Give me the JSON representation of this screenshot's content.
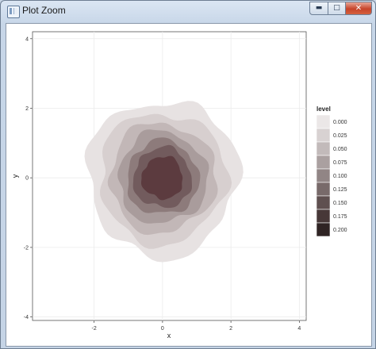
{
  "window": {
    "title": "Plot Zoom",
    "min_glyph": "▬",
    "max_glyph": "□",
    "close_glyph": "✕"
  },
  "chart_data": {
    "type": "contour",
    "title": "",
    "xlabel": "x",
    "ylabel": "y",
    "xlim": [
      -3.8,
      4.2
    ],
    "ylim": [
      -4.1,
      4.2
    ],
    "x_ticks": [
      "-2",
      "0",
      "2",
      "4"
    ],
    "y_ticks": [
      "4",
      "2",
      "0",
      "-2",
      "-4"
    ],
    "grid": true,
    "legend_position": "right",
    "legend": {
      "title": "level",
      "labels": [
        "0.000",
        "0.025",
        "0.050",
        "0.075",
        "0.100",
        "0.125",
        "0.150",
        "0.175",
        "0.200"
      ],
      "colors": [
        "#ebe7e7",
        "#d8d2d2",
        "#c2baba",
        "#aaa0a0",
        "#918585",
        "#786a6a",
        "#5f5050",
        "#473838",
        "#2f2424"
      ]
    },
    "center": [
      0,
      0
    ],
    "filled_levels": [
      {
        "level": "0.000",
        "radius": 2.2,
        "color": "#e7e2e2"
      },
      {
        "level": "0.025",
        "radius": 1.85,
        "color": "#d7cfcf"
      },
      {
        "level": "0.050",
        "radius": 1.55,
        "color": "#c2b7b7"
      },
      {
        "level": "0.075",
        "radius": 1.3,
        "color": "#a99c9c"
      },
      {
        "level": "0.100",
        "radius": 1.05,
        "color": "#8d7b7b"
      },
      {
        "level": "0.125",
        "radius": 0.85,
        "color": "#725b5d"
      },
      {
        "level": "0.150",
        "radius": 0.6,
        "color": "#5c3b3f"
      }
    ]
  }
}
